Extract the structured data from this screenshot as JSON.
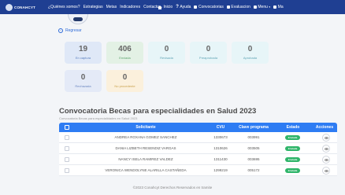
{
  "nav": {
    "logo_text": "CONAHCYT",
    "links": [
      "¿Quiénes somos?",
      "Estrategias",
      "Metas",
      "Indicadores",
      "Contacto"
    ],
    "right": [
      {
        "label": "Inicio",
        "icon": "home-icon"
      },
      {
        "label": "Ayuda",
        "icon": "help-icon"
      },
      {
        "label": "Convocatorias",
        "icon": "megaphone-icon"
      },
      {
        "label": "Evaluacion",
        "icon": "checklist-icon"
      },
      {
        "label": "Menu",
        "icon": "grid-menu-icon"
      },
      {
        "label": "Ma",
        "icon": "flag-icon"
      }
    ]
  },
  "back_label": "Regresar",
  "cards": [
    {
      "value": "19",
      "label": "En captura",
      "bg": "#dfe8f7",
      "label_color": "#5a7fbf"
    },
    {
      "value": "406",
      "label": "Enviada",
      "bg": "#e3f1e5",
      "label_color": "#5aa36b"
    },
    {
      "value": "0",
      "label": "Revisada",
      "bg": "#e7f5f8",
      "label_color": "#62a6b6"
    },
    {
      "value": "0",
      "label": "Preaprobada",
      "bg": "#e7f5f8",
      "label_color": "#62a6b6"
    },
    {
      "value": "0",
      "label": "Aprobada",
      "bg": "#e7f5f8",
      "label_color": "#62a6b6"
    },
    {
      "value": "0",
      "label": "Rechazada",
      "bg": "#e4eaf7",
      "label_color": "#6b86c0"
    },
    {
      "value": "0",
      "label": "No procedente",
      "bg": "#fbf0dc",
      "label_color": "#c9a24e"
    }
  ],
  "section": {
    "title": "Convocatoria Becas para especialidades en Salud 2023",
    "subtitle": "Convocatoria Becas para especialidades en Salud 2023"
  },
  "table": {
    "headers": {
      "applicant": "Solicitante",
      "cvu": "CVU",
      "program": "Clave programa",
      "status": "Estado",
      "actions": "Acciones"
    },
    "rows": [
      {
        "applicant": "ANDREA ROXANA GOMEZ SANCHEZ",
        "cvu": "1330673",
        "program": "003991",
        "status": "Enviada"
      },
      {
        "applicant": "DANIA LIZBETH RESENDIZ VARGAS",
        "cvu": "1310626",
        "program": "003505",
        "status": "Enviada"
      },
      {
        "applicant": "NANCY ISELA RAMIREZ VALDEZ",
        "cvu": "1311430",
        "program": "003695",
        "status": "Enviada"
      },
      {
        "applicant": "VERONICA WENDOLYNE ALARILLA CASTAÑEDA",
        "cvu": "1299219",
        "program": "005172",
        "status": "Enviada"
      }
    ]
  },
  "footer": "©2023 Conahcyt Derechos Reservados en tramite",
  "colors": {
    "navbar": "#1f3f92",
    "table_header": "#2e7cf3",
    "status_sent": "#2fb56a",
    "link": "#2d6ad8"
  }
}
